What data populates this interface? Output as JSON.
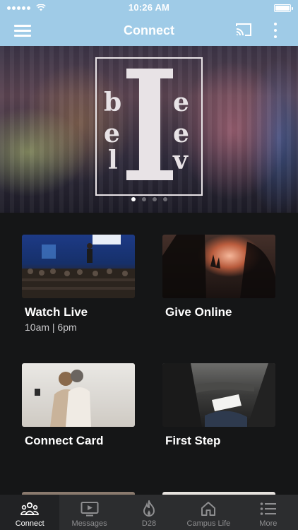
{
  "status_bar": {
    "time": "10:26 AM"
  },
  "app_bar": {
    "title": "Connect"
  },
  "hero": {
    "logo_letters": [
      "b",
      "e",
      "e",
      "e",
      "l",
      "v",
      "v",
      "e",
      "e"
    ],
    "slide_count": 4,
    "active_slide": 1
  },
  "cards": [
    {
      "title": "Watch Live",
      "subtitle": "10am | 6pm"
    },
    {
      "title": "Give Online",
      "subtitle": ""
    },
    {
      "title": "Connect Card",
      "subtitle": ""
    },
    {
      "title": "First Step",
      "subtitle": ""
    }
  ],
  "tabs": [
    {
      "label": "Connect",
      "icon": "people-icon",
      "active": true
    },
    {
      "label": "Messages",
      "icon": "play-screen-icon",
      "active": false
    },
    {
      "label": "D28",
      "icon": "flame-icon",
      "active": false
    },
    {
      "label": "Campus Life",
      "icon": "home-icon",
      "active": false
    },
    {
      "label": "More",
      "icon": "list-icon",
      "active": false
    }
  ],
  "colors": {
    "app_bar": "#9fcbe7",
    "background": "#151617",
    "tab_bar": "#2c2d2f",
    "inactive_tab": "#8e8e90"
  }
}
